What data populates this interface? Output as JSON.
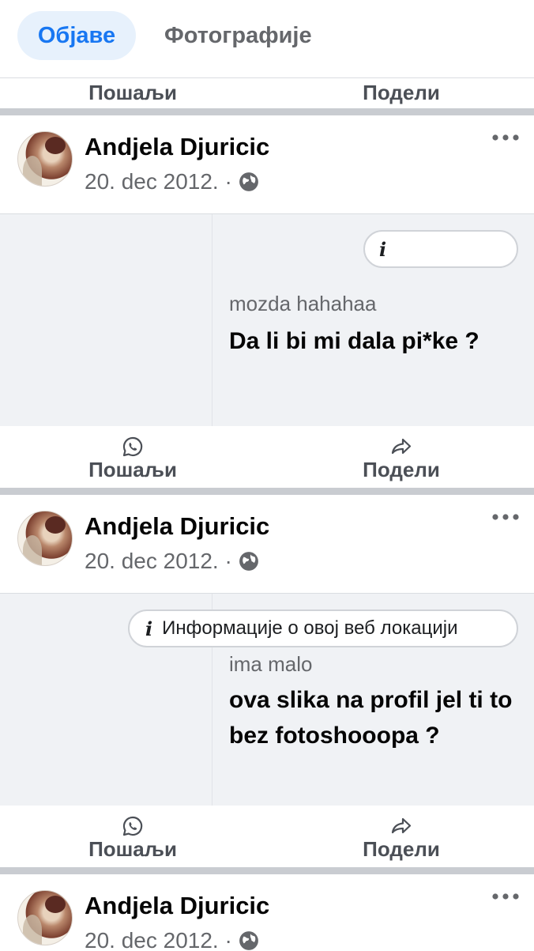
{
  "tabs": {
    "active": "Објаве",
    "other": "Фотографије"
  },
  "actions": {
    "send": "Пошаљи",
    "share": "Подели"
  },
  "posts": [
    {
      "author": "Andjela Djuricic",
      "date": "20. dec 2012. ·",
      "info_pill": "",
      "reply": "mozda hahahaa",
      "question": "Da li bi mi dala pi*ke ?"
    },
    {
      "author": "Andjela Djuricic",
      "date": "20. dec 2012. ·",
      "info_pill": "Информације о овој веб локацији",
      "reply": "ima malo",
      "question": "ova slika na profil jel ti to bez fotoshooopa ?"
    },
    {
      "author": "Andjela Djuricic",
      "date": "20. dec 2012. ·"
    }
  ],
  "icons": {
    "send": "whatsapp-icon",
    "share": "share-arrow-icon",
    "privacy": "globe-icon",
    "more": "more-dots-icon",
    "info": "info-icon"
  },
  "colors": {
    "accent": "#1877f2",
    "tab_active_bg": "#e7f1fc",
    "muted": "#65676b"
  }
}
